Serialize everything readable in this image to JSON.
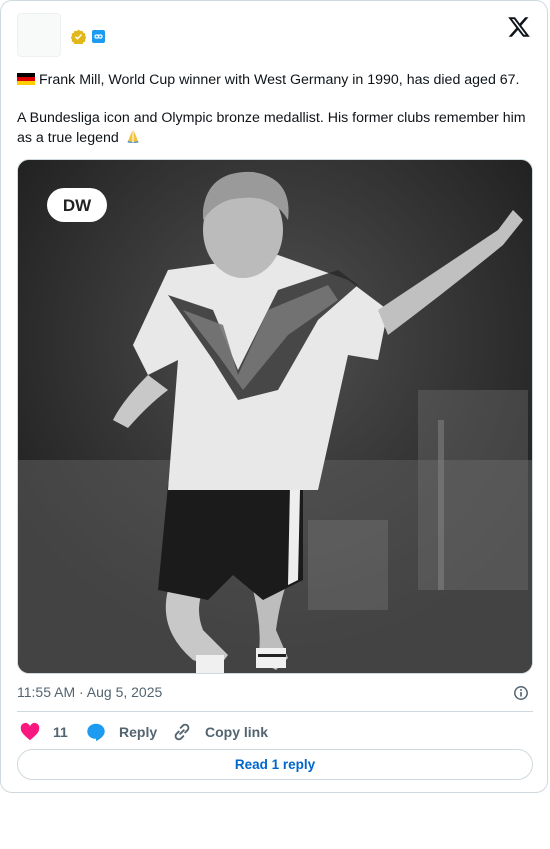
{
  "tweet": {
    "text_line1": "Frank Mill, World Cup winner with West Germany in 1990, has died aged 67.",
    "text_line2": "A Bundesliga icon and Olympic bronze medallist. His former clubs remember him as a true legend",
    "flag_emoji": "german-flag",
    "end_emoji": "folded-hands",
    "timestamp": "11:55 AM · Aug 5, 2025",
    "likes": "11",
    "reply_label": "Reply",
    "copy_label": "Copy link",
    "read_replies_label": "Read 1 reply"
  },
  "media": {
    "watermark": "DW"
  },
  "colors": {
    "like": "#f91880",
    "reply": "#1d9bf0",
    "link": "#0066cc",
    "muted": "#536471",
    "border": "#cfd9de"
  }
}
